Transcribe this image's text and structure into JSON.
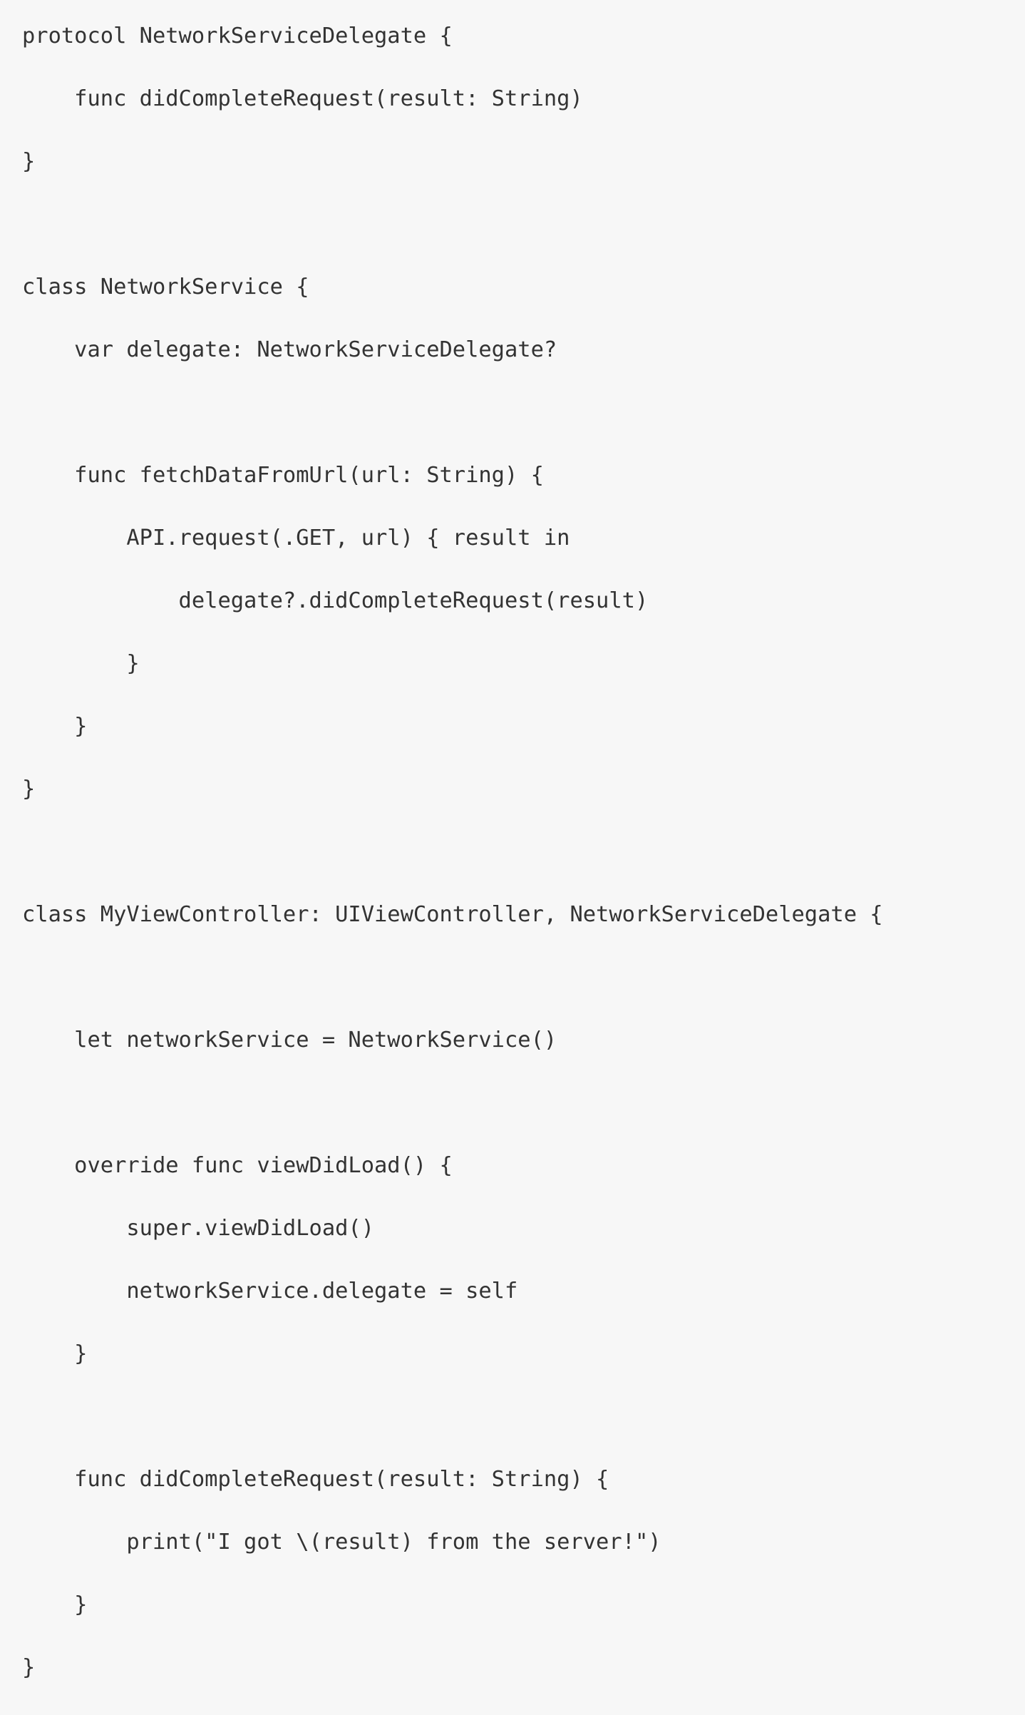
{
  "code": {
    "language": "Swift",
    "lines": [
      "protocol NetworkServiceDelegate {",
      "    func didCompleteRequest(result: String)",
      "}",
      "",
      "class NetworkService {",
      "    var delegate: NetworkServiceDelegate?",
      "",
      "    func fetchDataFromUrl(url: String) {",
      "        API.request(.GET, url) { result in",
      "            delegate?.didCompleteRequest(result)",
      "        }",
      "    }",
      "}",
      "",
      "class MyViewController: UIViewController, NetworkServiceDelegate {",
      "",
      "    let networkService = NetworkService()",
      "",
      "    override func viewDidLoad() {",
      "        super.viewDidLoad()",
      "        networkService.delegate = self",
      "    }",
      "",
      "    func didCompleteRequest(result: String) {",
      "        print(\"I got \\(result) from the server!\")",
      "    }",
      "}"
    ]
  },
  "colors": {
    "background": "#f7f7f7",
    "text": "#333333"
  }
}
